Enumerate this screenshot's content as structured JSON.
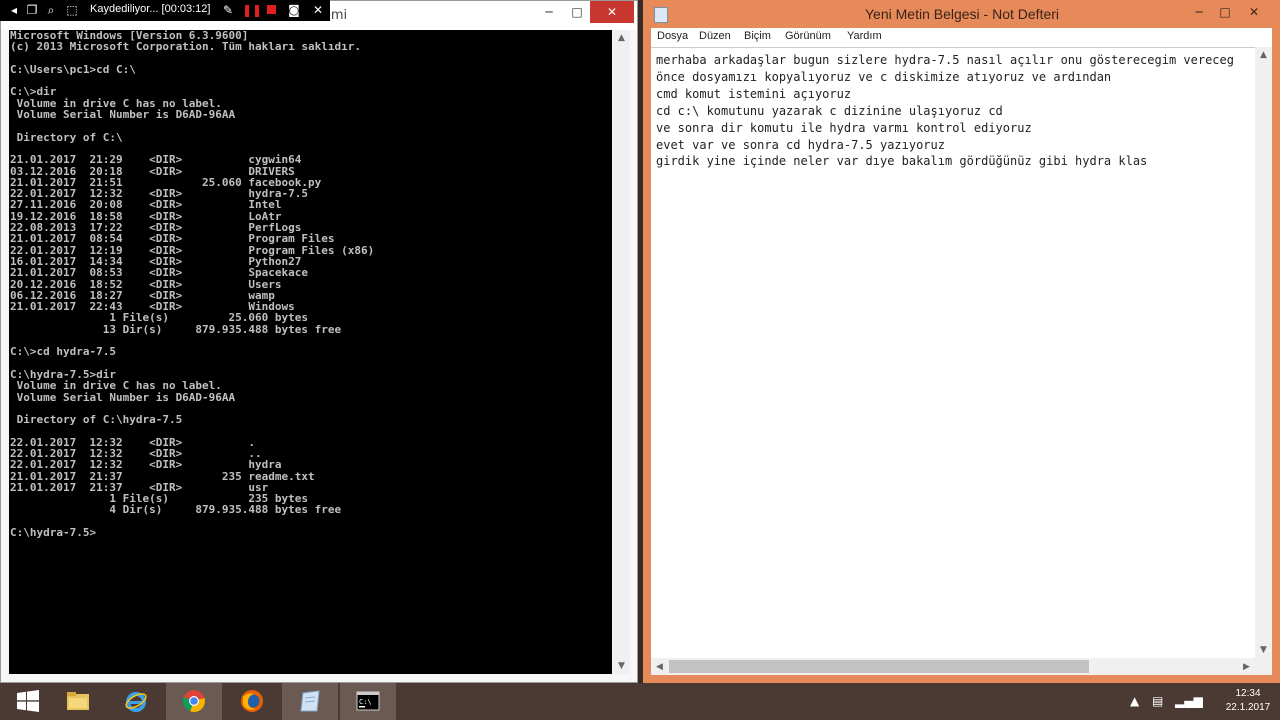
{
  "recorder": {
    "label": "Kaydediliyor... [00:03:12]"
  },
  "cmd": {
    "title_fragment": "stemi",
    "min": "─",
    "max": "□",
    "close": "✕",
    "scroll_up": "▲",
    "scroll_down": "▼",
    "console_text": "Microsoft Windows [Version 6.3.9600]\n(c) 2013 Microsoft Corporation. Tüm hakları saklıdır.\n\nC:\\Users\\pc1>cd C:\\\n\nC:\\>dir\n Volume in drive C has no label.\n Volume Serial Number is D6AD-96AA\n\n Directory of C:\\\n\n21.01.2017  21:29    <DIR>          cygwin64\n03.12.2016  20:18    <DIR>          DRIVERS\n21.01.2017  21:51            25.060 facebook.py\n22.01.2017  12:32    <DIR>          hydra-7.5\n27.11.2016  20:08    <DIR>          Intel\n19.12.2016  18:58    <DIR>          LoAtr\n22.08.2013  17:22    <DIR>          PerfLogs\n21.01.2017  08:54    <DIR>          Program Files\n22.01.2017  12:19    <DIR>          Program Files (x86)\n16.01.2017  14:34    <DIR>          Python27\n21.01.2017  08:53    <DIR>          Spacekace\n20.12.2016  18:52    <DIR>          Users\n06.12.2016  18:27    <DIR>          wamp\n21.01.2017  22:43    <DIR>          Windows\n               1 File(s)         25.060 bytes\n              13 Dir(s)     879.935.488 bytes free\n\nC:\\>cd hydra-7.5\n\nC:\\hydra-7.5>dir\n Volume in drive C has no label.\n Volume Serial Number is D6AD-96AA\n\n Directory of C:\\hydra-7.5\n\n22.01.2017  12:32    <DIR>          .\n22.01.2017  12:32    <DIR>          ..\n22.01.2017  12:32    <DIR>          hydra\n21.01.2017  21:37               235 readme.txt\n21.01.2017  21:37    <DIR>          usr\n               1 File(s)            235 bytes\n               4 Dir(s)     879.935.488 bytes free\n\nC:\\hydra-7.5>"
  },
  "notepad": {
    "title": "Yeni Metin Belgesi - Not Defteri",
    "min": "─",
    "max": "□",
    "close": "✕",
    "menu": [
      "Dosya",
      "Düzen",
      "Biçim",
      "Görünüm",
      "Yardım"
    ],
    "text": "merhaba arkadaşlar bugun sizlere hydra-7.5 nasıl açılır onu gösterecegim vereceg\nönce dosyamızı kopyalıyoruz ve c diskimize atıyoruz ve ardından\ncmd komut istemini açıyoruz\ncd c:\\ komutunu yazarak c dizinine ulaşıyoruz cd\nve sonra dir komutu ile hydra varmı kontrol ediyoruz\nevet var ve sonra cd hydra-7.5 yazıyoruz\ngirdik yine içinde neler var dıye bakalım gördüğünüz gibi hydra klas",
    "scroll_up": "▲",
    "scroll_down": "▼",
    "scroll_left": "◀",
    "scroll_right": "▶"
  },
  "taskbar": {
    "time": "12:34",
    "date": "22.1.2017",
    "tray_chevron": "▲"
  }
}
